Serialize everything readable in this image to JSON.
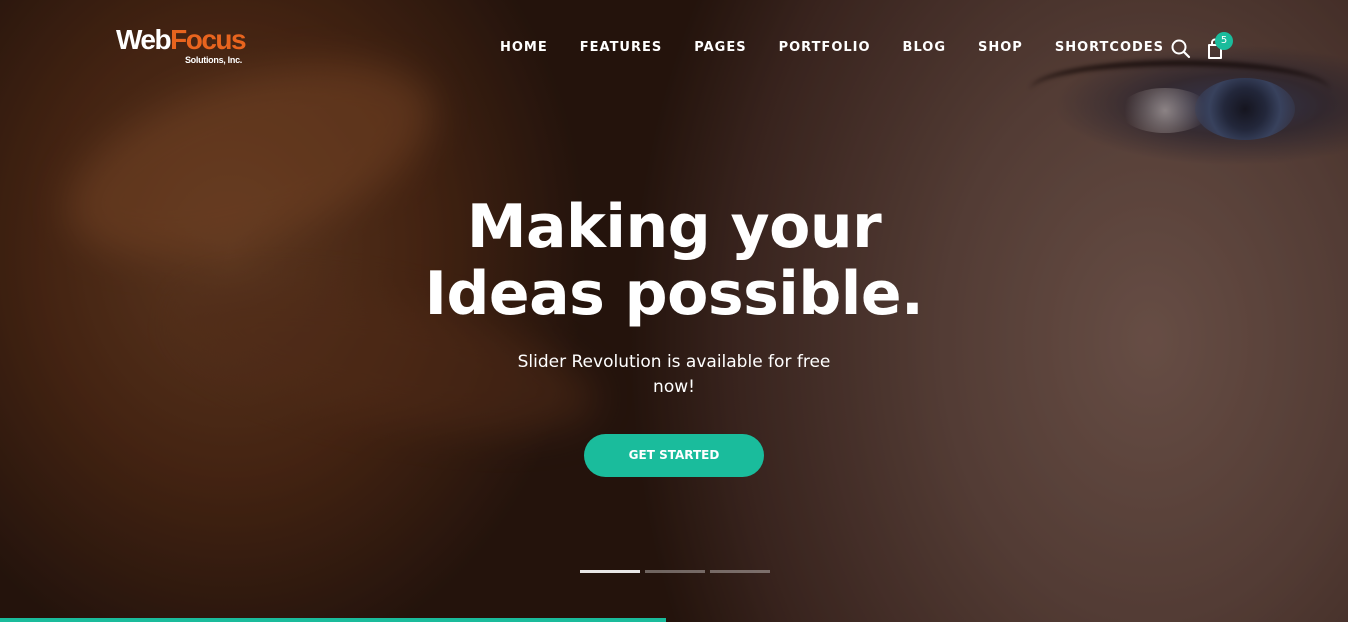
{
  "brand": {
    "logo_part1": "Web",
    "logo_part2": "Focus",
    "logo_sub": "Solutions, Inc.",
    "accent_color": "#1abc9c",
    "logo_orange": "#e8641e"
  },
  "nav": {
    "items": [
      {
        "label": "HOME"
      },
      {
        "label": "FEATURES"
      },
      {
        "label": "PAGES"
      },
      {
        "label": "PORTFOLIO"
      },
      {
        "label": "BLOG"
      },
      {
        "label": "SHOP"
      },
      {
        "label": "SHORTCODES"
      }
    ],
    "search_icon": "search-icon",
    "cart_icon": "shopping-bag-icon",
    "cart_count": "5"
  },
  "hero": {
    "headline_line1": "Making your",
    "headline_line2": "Ideas possible.",
    "subtext": "Slider Revolution is available for free now!",
    "cta_label": "GET STARTED",
    "slides_total": 3,
    "active_slide": 1,
    "progress": 0.494
  }
}
